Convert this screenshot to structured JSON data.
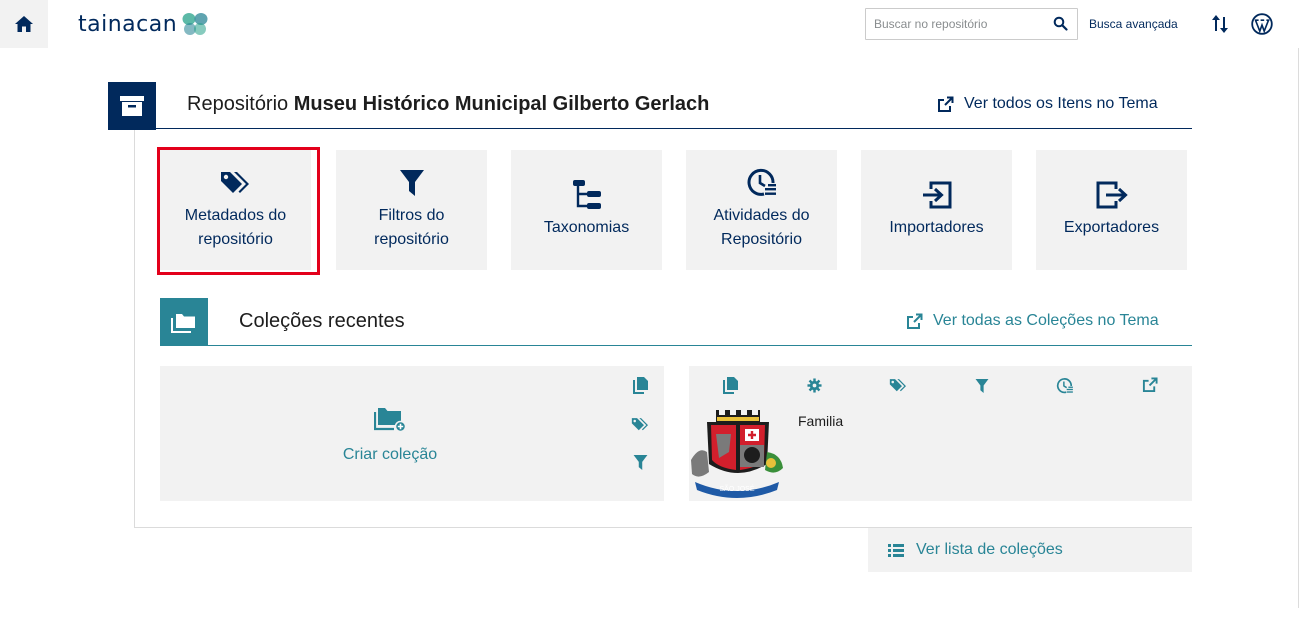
{
  "header": {
    "logo_text": "Tainacan",
    "search": {
      "placeholder": "Buscar no repositório",
      "value": ""
    },
    "advanced_search_label": "Busca avançada",
    "icons": [
      "home-icon",
      "search-icon",
      "sort-arrows-icon",
      "wordpress-icon"
    ]
  },
  "repository": {
    "title_prefix": "Repositório",
    "title_name": "Museu Histórico Municipal Gilberto Gerlach",
    "view_items_label": "Ver todos os Itens no Tema",
    "tiles": [
      {
        "label": "Metadados do repositório",
        "icon": "tags-icon",
        "highlighted": true
      },
      {
        "label": "Filtros do repositório",
        "icon": "filter-icon",
        "highlighted": false
      },
      {
        "label": "Taxonomias",
        "icon": "taxonomy-icon",
        "highlighted": false
      },
      {
        "label": "Atividades do Repositório",
        "icon": "activities-icon",
        "highlighted": false
      },
      {
        "label": "Importadores",
        "icon": "importer-icon",
        "highlighted": false
      },
      {
        "label": "Exportadores",
        "icon": "exporter-icon",
        "highlighted": false
      }
    ]
  },
  "collections": {
    "title": "Coleções recentes",
    "view_all_label": "Ver todas as Coleções no Tema",
    "create_label": "Criar coleção",
    "items": [
      {
        "name": "Familia",
        "thumbnail": "sao-jose-coat-of-arms"
      }
    ],
    "list_link_label": "Ver lista de coleções"
  },
  "colors": {
    "primary": "#01295c",
    "secondary": "#298596",
    "tile_bg": "#f2f2f2",
    "highlight_border": "#e3001b"
  }
}
